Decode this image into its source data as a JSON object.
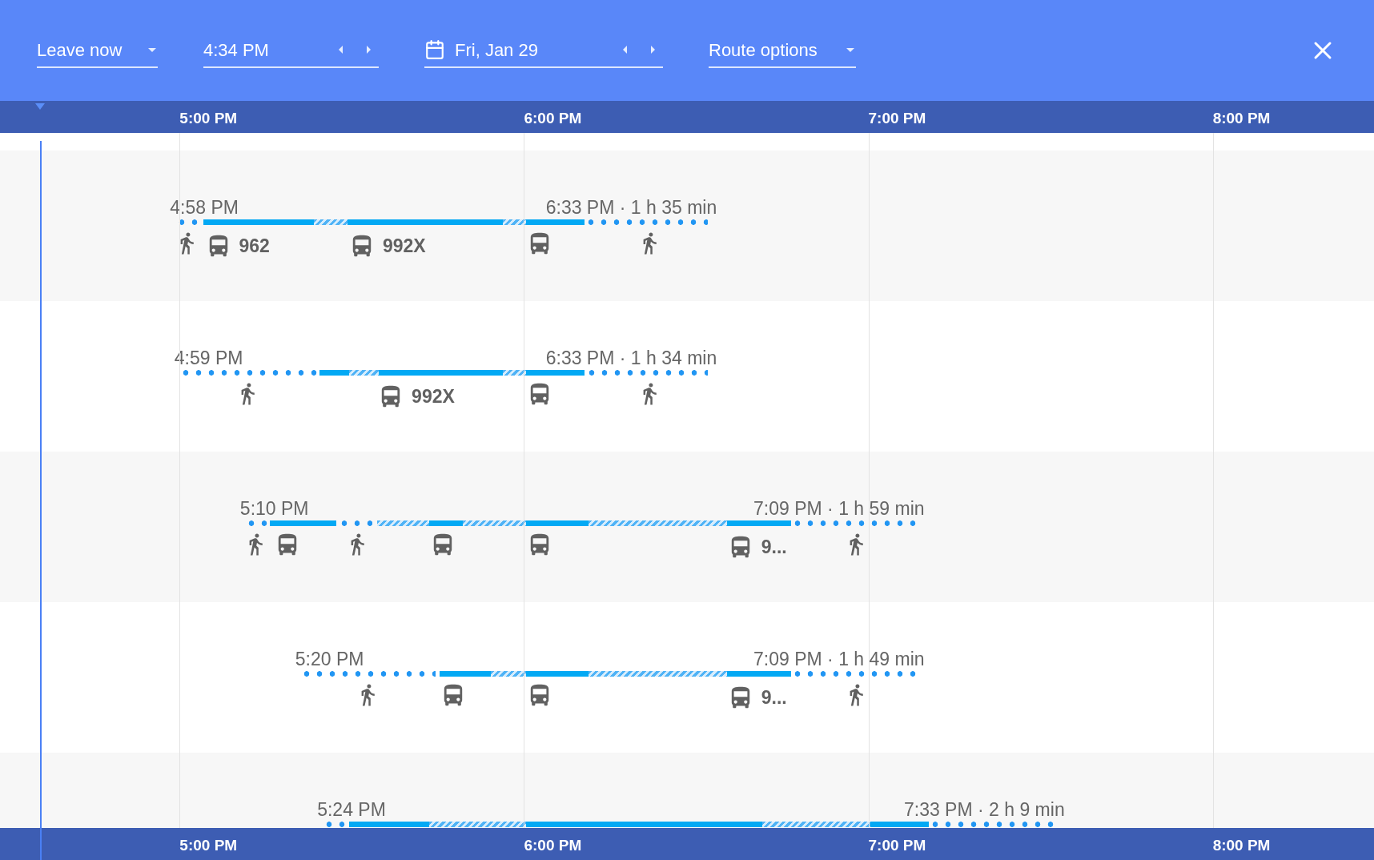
{
  "controls": {
    "departure": {
      "value": "Leave now"
    },
    "time": {
      "value": "4:34 PM"
    },
    "date": {
      "value": "Fri, Jan 29"
    },
    "route_options": {
      "label": "Route options"
    }
  },
  "timeline_top": [
    "5:00 PM",
    "6:00 PM",
    "7:00 PM",
    "8:00 PM"
  ],
  "routes": [
    {
      "depart": "4:58 PM",
      "arrival": "6:33 PM · 1 h 35 min",
      "segments": [
        {
          "kind": "walk"
        },
        {
          "kind": "bus"
        },
        {
          "kind": "wait"
        },
        {
          "kind": "bus"
        },
        {
          "kind": "wait"
        },
        {
          "kind": "bus"
        },
        {
          "kind": "walk"
        }
      ],
      "icons": [
        {
          "kind": "walk"
        },
        {
          "kind": "bus",
          "label": "962"
        },
        {
          "kind": "bus",
          "label": "992X"
        },
        {
          "kind": "bus"
        },
        {
          "kind": "walk"
        }
      ]
    },
    {
      "depart": "4:59 PM",
      "arrival": "6:33 PM · 1 h 34 min",
      "segments": [
        {
          "kind": "walk"
        },
        {
          "kind": "bus"
        },
        {
          "kind": "wait"
        },
        {
          "kind": "bus"
        },
        {
          "kind": "wait"
        },
        {
          "kind": "bus"
        },
        {
          "kind": "walk"
        }
      ],
      "icons": [
        {
          "kind": "walk"
        },
        {
          "kind": "bus",
          "label": "992X"
        },
        {
          "kind": "bus"
        },
        {
          "kind": "walk"
        }
      ]
    },
    {
      "depart": "5:10 PM",
      "arrival": "7:09 PM · 1 h 59 min",
      "segments": [
        {
          "kind": "walk"
        },
        {
          "kind": "bus"
        },
        {
          "kind": "walk"
        },
        {
          "kind": "wait"
        },
        {
          "kind": "bus"
        },
        {
          "kind": "wait"
        },
        {
          "kind": "bus"
        },
        {
          "kind": "wait"
        },
        {
          "kind": "bus"
        },
        {
          "kind": "walk"
        }
      ],
      "icons": [
        {
          "kind": "walk"
        },
        {
          "kind": "bus"
        },
        {
          "kind": "walk"
        },
        {
          "kind": "bus"
        },
        {
          "kind": "bus"
        },
        {
          "kind": "bus",
          "label": "9..."
        },
        {
          "kind": "walk"
        }
      ]
    },
    {
      "depart": "5:20 PM",
      "arrival": "7:09 PM · 1 h 49 min",
      "segments": [
        {
          "kind": "walk"
        },
        {
          "kind": "bus"
        },
        {
          "kind": "wait"
        },
        {
          "kind": "bus"
        },
        {
          "kind": "wait"
        },
        {
          "kind": "bus"
        },
        {
          "kind": "walk"
        }
      ],
      "icons": [
        {
          "kind": "walk"
        },
        {
          "kind": "bus"
        },
        {
          "kind": "bus"
        },
        {
          "kind": "bus",
          "label": "9..."
        },
        {
          "kind": "walk"
        }
      ]
    },
    {
      "depart": "5:24 PM",
      "arrival": "7:33 PM · 2 h 9 min",
      "segments": [
        {
          "kind": "walk"
        },
        {
          "kind": "bus"
        },
        {
          "kind": "wait"
        },
        {
          "kind": "bus"
        },
        {
          "kind": "wait"
        },
        {
          "kind": "bus"
        },
        {
          "kind": "walk"
        }
      ]
    }
  ],
  "timeline_bottom": [
    "5:00 PM",
    "6:00 PM",
    "7:00 PM",
    "8:00 PM"
  ]
}
